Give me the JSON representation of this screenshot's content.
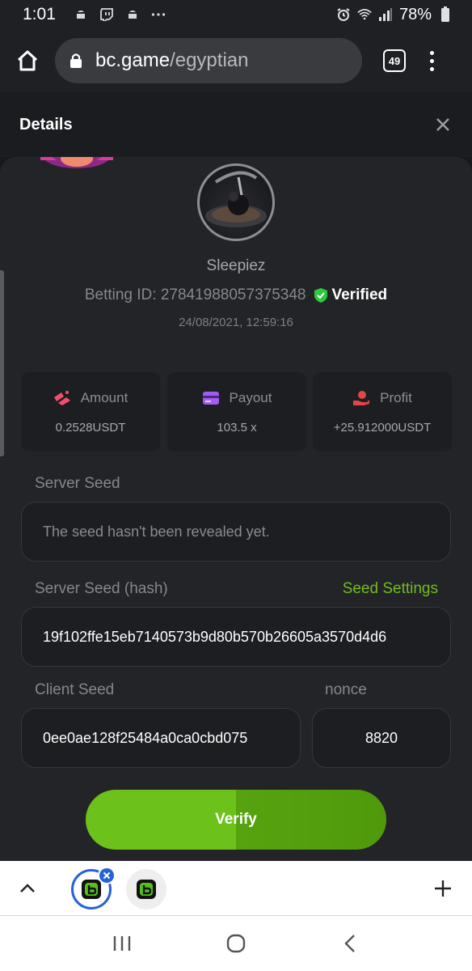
{
  "status_bar": {
    "time": "1:01",
    "battery": "78%",
    "icons": [
      "android-icon",
      "twitch-icon",
      "android-icon",
      "more-dots-icon",
      "alarm-icon",
      "wifi-icon",
      "signal-icon",
      "battery-icon"
    ]
  },
  "browser": {
    "url_domain": "bc.game",
    "url_path": "/egyptian",
    "tab_count": "49"
  },
  "details": {
    "title": "Details"
  },
  "bet": {
    "username": "Sleepiez",
    "betting_id": "Betting ID: 27841988057375348",
    "verified_label": "Verified",
    "timestamp": "24/08/2021, 12:59:16",
    "stats": [
      {
        "label": "Amount",
        "value": "0.2528USDT",
        "icon": "amount-icon",
        "color": "#f0506e"
      },
      {
        "label": "Payout",
        "value": "103.5 x",
        "icon": "card-icon",
        "color": "#a35cf0"
      },
      {
        "label": "Profit",
        "value": "+25.912000USDT",
        "icon": "profit-hand-icon",
        "color": "#e34646"
      }
    ]
  },
  "seeds": {
    "server_seed_label": "Server Seed",
    "server_seed_value": "The seed hasn't been revealed yet.",
    "server_hash_label": "Server Seed (hash)",
    "seed_settings_label": "Seed Settings",
    "server_hash_value": "19f102ffe15eb7140573b9d80b570b26605a3570d4d6",
    "client_seed_label": "Client Seed",
    "client_seed_value": "0ee0ae128f25484a0ca0cbd075",
    "nonce_label": "nonce",
    "nonce_value": "8820"
  },
  "actions": {
    "verify_label": "Verify"
  },
  "colors": {
    "accent_green": "#6fbd1e",
    "verified_green": "#2ec83e",
    "tab_active_blue": "#2563d8"
  }
}
